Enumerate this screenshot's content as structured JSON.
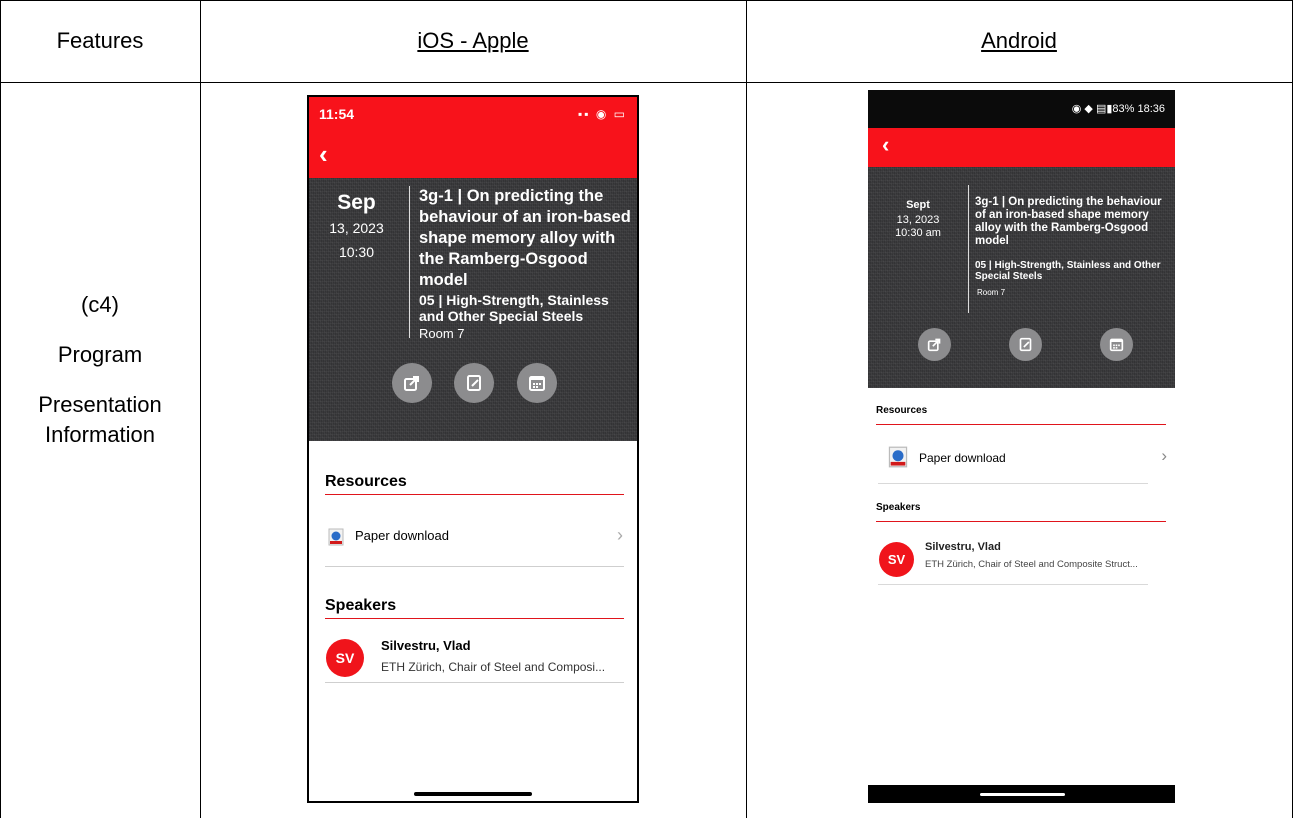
{
  "table": {
    "headers": [
      "Features",
      "iOS - Apple",
      "Android"
    ],
    "feature": {
      "code": "(c4)",
      "line1": "Program",
      "line2": "Presentation",
      "line3": "Information"
    }
  },
  "ios": {
    "status_time": "11:54",
    "status_icons": "▪▪ ◉ ▭",
    "back": "‹",
    "date": {
      "month": "Sep",
      "day": "13, 2023",
      "time": "10:30"
    },
    "title": "3g-1 | On predicting the behaviour of an iron-based shape memory alloy with the Ramberg-Osgood model",
    "session": "05 | High-Strength, Stainless and Other Special Steels",
    "room": "Room 7",
    "resources_label": "Resources",
    "resource_item": "Paper download",
    "speakers_label": "Speakers",
    "speaker": {
      "initials": "SV",
      "name": "Silvestru, Vlad",
      "affiliation": "ETH Zürich, Chair of Steel and Composi..."
    }
  },
  "android": {
    "status_right": "◉ ◆ ▤▮83% 18:36",
    "back": "‹",
    "date": {
      "month": "Sept",
      "day": "13, 2023",
      "time": "10:30 am"
    },
    "title": "3g-1 | On predicting the behaviour of an iron-based shape memory alloy with the Ramberg-Osgood model",
    "session": "05 | High-Strength, Stainless and Other Special Steels",
    "room": "Room 7",
    "resources_label": "Resources",
    "resource_item": "Paper download",
    "speakers_label": "Speakers",
    "speaker": {
      "initials": "SV",
      "name": "Silvestru, Vlad",
      "affiliation": "ETH Zürich, Chair of Steel and Composite Struct..."
    }
  },
  "colors": {
    "accent_red": "#f8121b",
    "hero_dark": "#3a3a3c",
    "button_grey": "#8c8c8e"
  },
  "icons": [
    "back-chevron-icon",
    "share-icon",
    "note-edit-icon",
    "calendar-icon",
    "web-document-icon",
    "chevron-right-icon"
  ]
}
